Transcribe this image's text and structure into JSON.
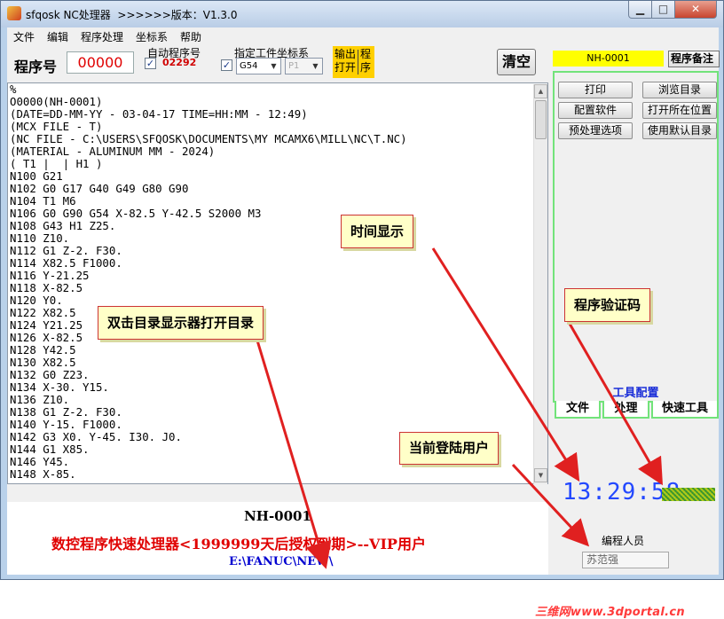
{
  "window": {
    "title": "sfqosk NC处理器  >>>>>>版本：V1.3.0",
    "min_icon": "minimize-icon",
    "max_icon": "maximize-icon",
    "close_icon": "close-icon"
  },
  "menu": [
    "文件",
    "编辑",
    "程序处理",
    "坐标系",
    "帮助"
  ],
  "toolbar": {
    "program_label": "程序号",
    "program_number": "00000",
    "auto_program_label": "自动程序号",
    "auto_program_number": "02292",
    "coord_label": "指定工件坐标系",
    "coord_value": "G54",
    "coord_sub_value": "P1",
    "output_label_a": "输出",
    "output_label_b": "打开",
    "output_label_c": "程",
    "output_label_d": "序",
    "clear_label": "清空"
  },
  "editor": {
    "lines": [
      "%",
      "O0000(NH-0001)",
      "(DATE=DD-MM-YY - 03-04-17 TIME=HH:MM - 12:49)",
      "(MCX FILE - T)",
      "(NC FILE - C:\\USERS\\SFQOSK\\DOCUMENTS\\MY MCAMX6\\MILL\\NC\\T.NC)",
      "(MATERIAL - ALUMINUM MM - 2024)",
      "( T1 |  | H1 )",
      "N100 G21",
      "N102 G0 G17 G40 G49 G80 G90",
      "N104 T1 M6",
      "N106 G0 G90 G54 X-82.5 Y-42.5 S2000 M3",
      "N108 G43 H1 Z25.",
      "N110 Z10.",
      "N112 G1 Z-2. F30.",
      "N114 X82.5 F1000.",
      "N116 Y-21.25",
      "N118 X-82.5",
      "N120 Y0.",
      "N122 X82.5",
      "N124 Y21.25",
      "N126 X-82.5",
      "N128 Y42.5",
      "N130 X82.5",
      "N132 G0 Z23.",
      "N134 X-30. Y15.",
      "N136 Z10.",
      "N138 G1 Z-2. F30.",
      "N140 Y-15. F1000.",
      "N142 G3 X0. Y-45. I30. J0.",
      "N144 G1 X85.",
      "N146 Y45.",
      "N148 X-85."
    ]
  },
  "status": {
    "file_name": "NH-0001",
    "vip_text": "数控程序快速处理器<1999999天后授权到期>--VIP用户",
    "path": "E:\\FANUC\\NEW\\"
  },
  "right_panel": {
    "program_code": "NH-0001",
    "note_button": "程序备注",
    "buttons": {
      "print": "打印",
      "browse": "浏览目录",
      "config": "配置软件",
      "open_location": "打开所在位置",
      "preprocess": "预处理选项",
      "default_dir": "使用默认目录"
    },
    "tool_config_label": "工具配置",
    "tabs": [
      "文件",
      "处理",
      "快速工具"
    ],
    "clock": "13:29:58",
    "editor_label": "编程人员",
    "user": "苏范强",
    "watermark": "三维网www.3dportal.cn"
  },
  "callouts": {
    "time": "时间显示",
    "verify": "程序验证码",
    "dblclick": "双击目录显示器打开目录",
    "user": "当前登陆用户"
  },
  "colors": {
    "accent_red": "#e00000",
    "path_blue": "#0000d0",
    "clock_blue": "#2348ff",
    "highlight_yellow": "#ffff00",
    "panel_green": "#72e37a",
    "arrow_red": "#e02020"
  }
}
